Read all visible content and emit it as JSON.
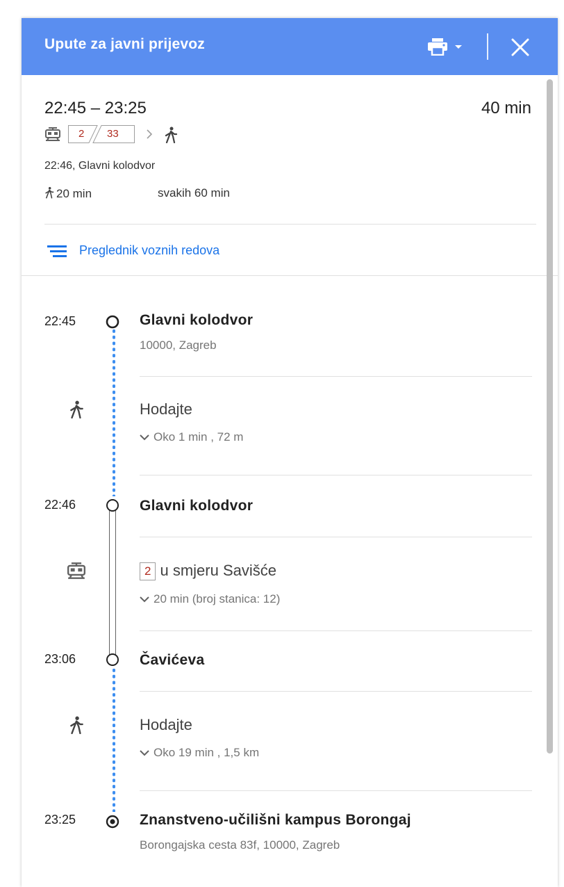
{
  "header": {
    "title": "Upute za javni prijevoz",
    "bg_color": "#5a8ef0",
    "print_icon": "print-icon",
    "close_icon": "close-icon"
  },
  "summary": {
    "time_range": "22:45 – 23:25",
    "duration": "40 min",
    "route_lines": [
      "2",
      "33"
    ],
    "departure": "22:46, Glavni kolodvor",
    "walk_total": "20 min",
    "frequency": "svakih 60 min",
    "line_color": "#b02a1e"
  },
  "timetable_link": "Preglednik voznih redova",
  "itinerary": {
    "stop1": {
      "time": "22:45",
      "name": "Glavni kolodvor",
      "address": "10000, Zagreb"
    },
    "walk1": {
      "title": "Hodajte",
      "detail": "Oko 1 min , 72 m"
    },
    "stop2": {
      "time": "22:46",
      "name": "Glavni kolodvor"
    },
    "tram": {
      "line": "2",
      "direction": "u smjeru Savišće",
      "detail": "20 min (broj stanica: 12)"
    },
    "stop3": {
      "time": "23:06",
      "name": "Čavićeva"
    },
    "walk2": {
      "title": "Hodajte",
      "detail": "Oko 19 min , 1,5 km"
    },
    "stop4": {
      "time": "23:25",
      "name": "Znanstveno-učilišni kampus Borongaj",
      "address": "Borongajska cesta 83f, 10000, Zagreb"
    }
  },
  "colors": {
    "accent": "#1a73e8",
    "walk_dots": "#3d8ef0"
  }
}
